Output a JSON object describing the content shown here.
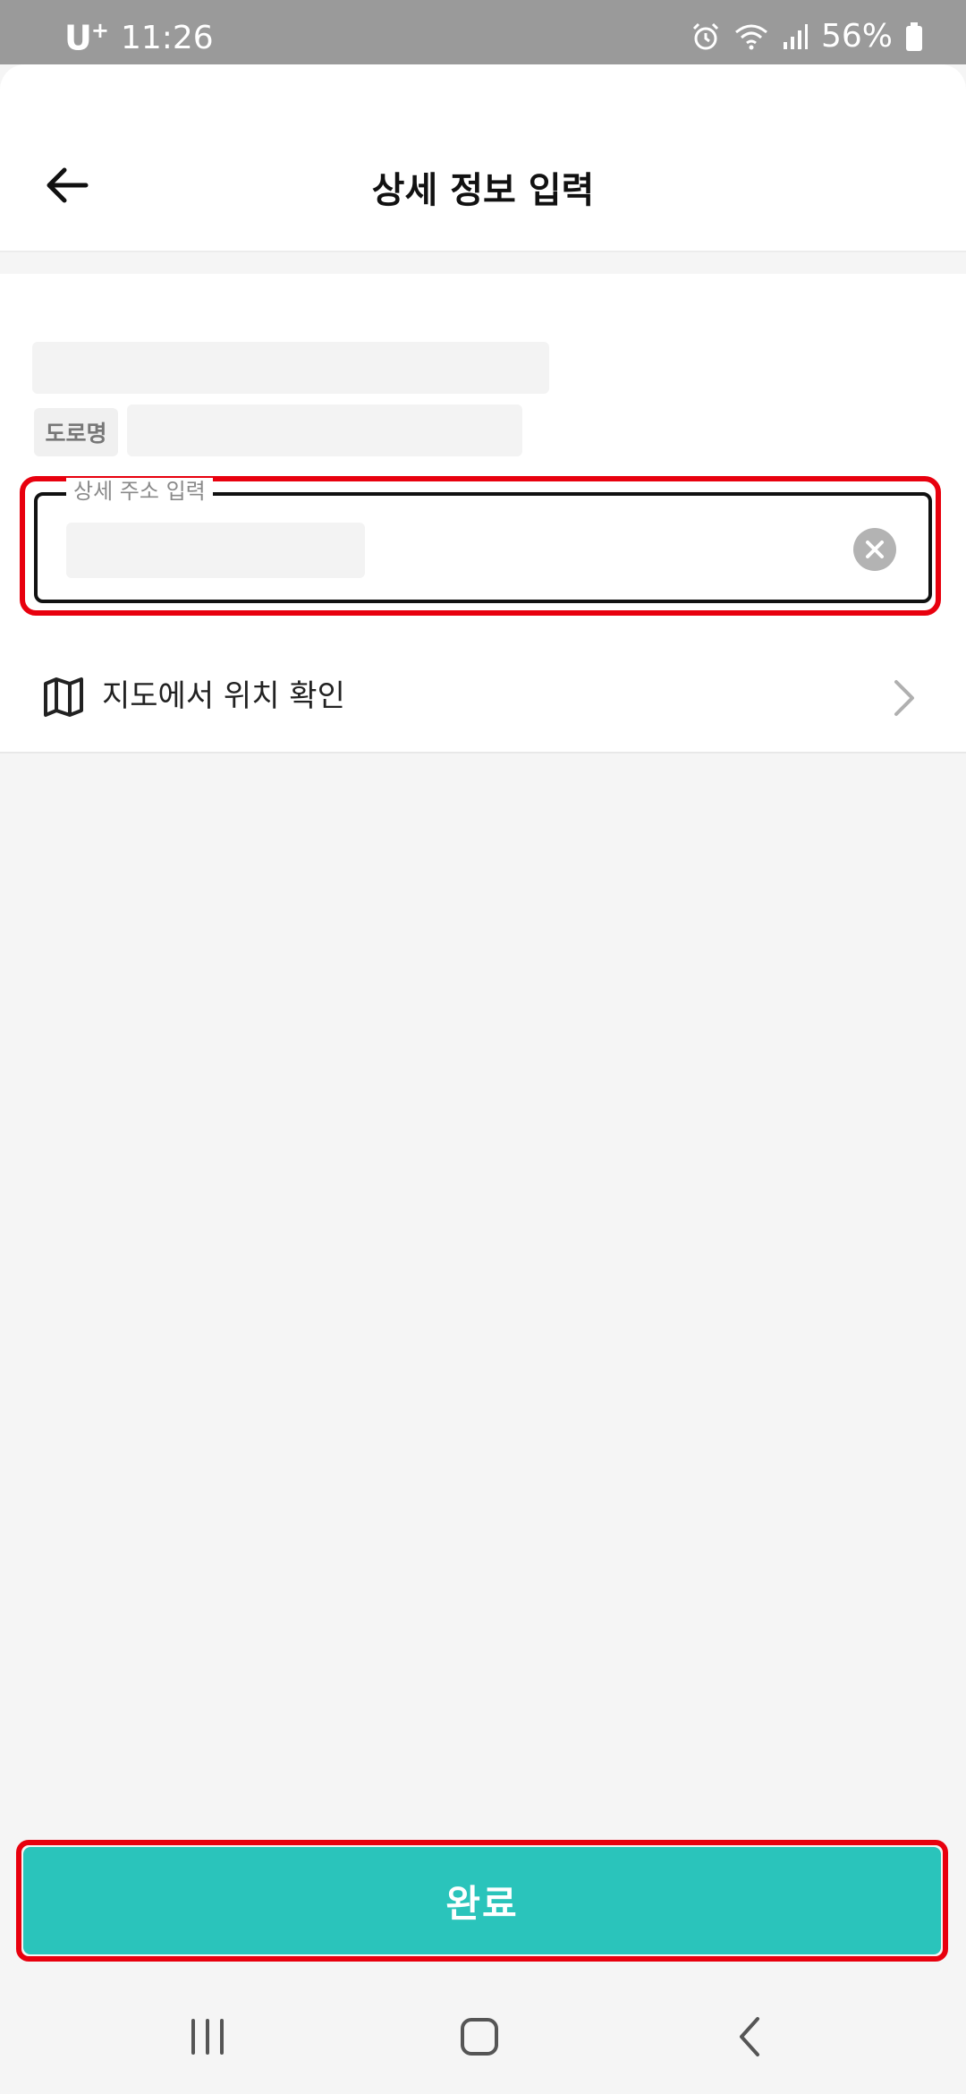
{
  "status_bar": {
    "carrier": "U",
    "carrier_sup": "+",
    "time": "11:26",
    "battery": "56%",
    "icons": [
      "alarm-icon",
      "wifi-icon",
      "signal-icon",
      "battery-icon"
    ]
  },
  "header": {
    "title": "상세 정보 입력",
    "back_icon": "arrow-left-icon"
  },
  "address": {
    "road_badge": "도로명",
    "detail_label": "상세 주소 입력",
    "detail_value": "",
    "clear_icon": "clear-circle-icon"
  },
  "map_link": {
    "label": "지도에서 위치 확인",
    "icon": "map-icon",
    "chevron": "chevron-right-icon"
  },
  "footer": {
    "complete_label": "완료"
  },
  "navigation": {
    "recent_icon": "recent-apps-icon",
    "home_icon": "home-icon",
    "back_icon": "nav-back-icon"
  },
  "colors": {
    "accent": "#2ac4bb",
    "highlight": "#e8000e",
    "status_bar": "#9a9a9a"
  }
}
